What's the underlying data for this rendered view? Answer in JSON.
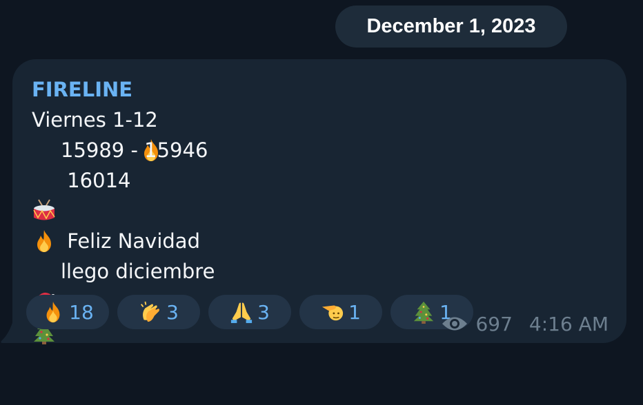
{
  "date_pill": "December 1, 2023",
  "message": {
    "sender": "FIRELINE",
    "sender_emoji": "fire",
    "lines": [
      {
        "emoji": null,
        "text": "Viernes 1-12"
      },
      {
        "emoji": "drum",
        "text": "15989 - 15946"
      },
      {
        "emoji": "fire",
        "text": " 16014"
      },
      {
        "emoji": null,
        "text": ""
      },
      {
        "emoji": "santa",
        "text": " Feliz Navidad"
      },
      {
        "emoji": "christmas-tree",
        "text": "llego diciembre"
      }
    ],
    "views": "697",
    "time": "4:16 AM"
  },
  "reactions": [
    {
      "emoji": "fire",
      "count": "18"
    },
    {
      "emoji": "clapping-hands",
      "count": "3"
    },
    {
      "emoji": "folded-hands",
      "count": "3"
    },
    {
      "emoji": "saluting-hand",
      "count": "1"
    },
    {
      "emoji": "christmas-tree",
      "count": "1"
    }
  ],
  "colors": {
    "background": "#0e1621",
    "bubble": "#182533",
    "pill": "#1e2c3a",
    "reaction": "#233447",
    "accent": "#6ab3f3",
    "meta": "#6d7f8f"
  }
}
